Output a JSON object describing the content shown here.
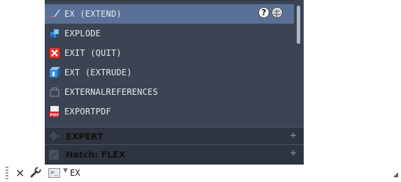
{
  "autocomplete": {
    "items": [
      {
        "label": "EX (EXTEND)",
        "icon": "extend-icon",
        "selected": true
      },
      {
        "label": "EXPLODE",
        "icon": "explode-icon"
      },
      {
        "label": "EXIT (QUIT)",
        "icon": "exit-icon"
      },
      {
        "label": "EXT (EXTRUDE)",
        "icon": "extrude-icon"
      },
      {
        "label": "EXTERNALREFERENCES",
        "icon": "external-references-icon"
      },
      {
        "label": "EXPORTPDF",
        "icon": "pdf-icon"
      }
    ],
    "selected_row_icons": [
      "help-icon",
      "globe-icon"
    ],
    "help_glyph": "?",
    "categories": [
      {
        "label": "EXPERT",
        "expand": "+"
      },
      {
        "label": "Hatch: FLEX",
        "expand": "+"
      }
    ]
  },
  "command_line": {
    "input_value": "EX",
    "close_glyph": "✕",
    "prompt_glyph": ">_",
    "arrow_glyph": "▼",
    "resize_glyph": "◢"
  },
  "colors": {
    "popup_bg": "#3b4453",
    "selected_row": "#5a7096",
    "category_bg": "#2e3440"
  }
}
